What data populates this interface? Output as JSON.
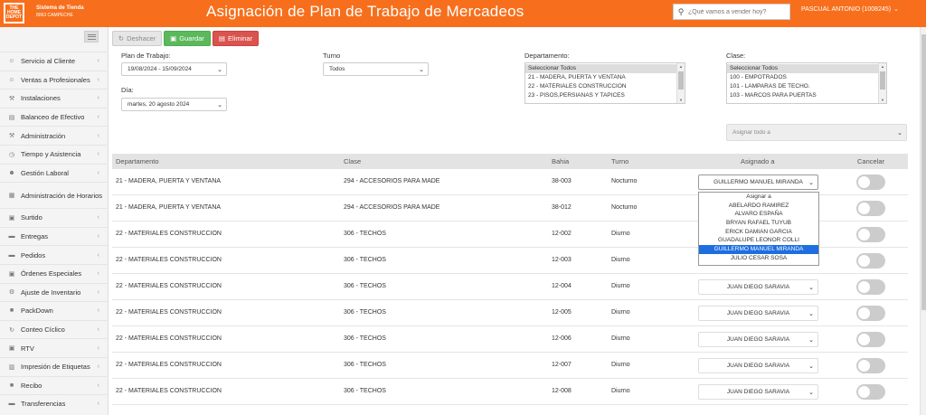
{
  "header": {
    "logo_text": "THE HOME DEPOT",
    "store_name": "Sistema de Tienda",
    "store_sub": "8063 CAMPECHE",
    "title": "Asignación de Plan de Trabajo de Mercadeos",
    "search_placeholder": "¿Qué vamos a vender hoy?",
    "user": "PASCUAL ANTONIO (1008245)"
  },
  "sidebar": {
    "items": [
      {
        "label": "Servicio al Cliente",
        "icon": "user-icon"
      },
      {
        "label": "Ventas a Profesionales",
        "icon": "user-icon"
      },
      {
        "label": "Instalaciones",
        "icon": "wrench-icon"
      },
      {
        "label": "Balanceo de Efectivo",
        "icon": "money-icon"
      },
      {
        "label": "Administración",
        "icon": "wrench-icon"
      },
      {
        "label": "Tiempo y Asistencia",
        "icon": "clock-icon"
      },
      {
        "label": "Gestión Laboral",
        "icon": "users-icon"
      },
      {
        "label": "Administración de Horarios",
        "icon": "calendar-icon"
      },
      {
        "label": "Surtido",
        "icon": "cart-icon"
      },
      {
        "label": "Entregas",
        "icon": "truck-icon"
      },
      {
        "label": "Pedidos",
        "icon": "truck-icon"
      },
      {
        "label": "Órdenes Especiales",
        "icon": "cart-icon"
      },
      {
        "label": "Ajuste de Inventario",
        "icon": "gear-icon"
      },
      {
        "label": "PackDown",
        "icon": "box-icon"
      },
      {
        "label": "Conteo Cíclico",
        "icon": "refresh-icon"
      },
      {
        "label": "RTV",
        "icon": "cart-icon"
      },
      {
        "label": "Impresión de Etiquetas",
        "icon": "print-icon"
      },
      {
        "label": "Recibo",
        "icon": "box-icon"
      },
      {
        "label": "Transferencias",
        "icon": "truck-icon"
      }
    ]
  },
  "toolbar": {
    "undo": "Deshacer",
    "save": "Guardar",
    "delete": "Eliminar"
  },
  "filters": {
    "plan_label": "Plan de Trabajo:",
    "plan_value": "19/08/2024 - 15/09/2024",
    "dia_label": "Día:",
    "dia_value": "martes, 20 agosto 2024",
    "turno_label": "Turno",
    "turno_value": "Todos",
    "departamento_label": "Departamento:",
    "departamento_options": [
      "Seleccionar Todos",
      "21 - MADERA, PUERTA Y VENTANA",
      "22 - MATERIALES CONSTRUCCION",
      "23 - PISOS,PERSIANAS Y TAPICES"
    ],
    "clase_label": "Clase:",
    "clase_options": [
      "Seleccionar Todos",
      "100 - EMPOTRADOS",
      "101 - LAMPARAS DE TECHO.",
      "103 - MARCOS PARA PUERTAS"
    ],
    "asignar_todo": "Asignar todo a"
  },
  "table": {
    "headers": {
      "departamento": "Departamento",
      "clase": "Clase",
      "bahia": "Bahia",
      "turno": "Turno",
      "asignado": "Asignado a",
      "cancelar": "Cancelar"
    },
    "rows": [
      {
        "departamento": "21 - MADERA, PUERTA Y VENTANA",
        "clase": "294 - ACCESORIOS PARA MADE",
        "bahia": "38-003",
        "turno": "Nocturno",
        "asignado": "GUILLERMO MANUEL MIRANDA"
      },
      {
        "departamento": "21 - MADERA, PUERTA Y VENTANA",
        "clase": "294 - ACCESORIOS PARA MADE",
        "bahia": "38-012",
        "turno": "Nocturno",
        "asignado": ""
      },
      {
        "departamento": "22 - MATERIALES CONSTRUCCION",
        "clase": "306 - TECHOS",
        "bahia": "12-002",
        "turno": "Diurno",
        "asignado": ""
      },
      {
        "departamento": "22 - MATERIALES CONSTRUCCION",
        "clase": "306 - TECHOS",
        "bahia": "12-003",
        "turno": "Diurno",
        "asignado": ""
      },
      {
        "departamento": "22 - MATERIALES CONSTRUCCION",
        "clase": "306 - TECHOS",
        "bahia": "12-004",
        "turno": "Diurno",
        "asignado": "JUAN DIEGO SARAVIA"
      },
      {
        "departamento": "22 - MATERIALES CONSTRUCCION",
        "clase": "306 - TECHOS",
        "bahia": "12-005",
        "turno": "Diurno",
        "asignado": "JUAN DIEGO SARAVIA"
      },
      {
        "departamento": "22 - MATERIALES CONSTRUCCION",
        "clase": "306 - TECHOS",
        "bahia": "12-006",
        "turno": "Diurno",
        "asignado": "JUAN DIEGO SARAVIA"
      },
      {
        "departamento": "22 - MATERIALES CONSTRUCCION",
        "clase": "306 - TECHOS",
        "bahia": "12-007",
        "turno": "Diurno",
        "asignado": "JUAN DIEGO SARAVIA"
      },
      {
        "departamento": "22 - MATERIALES CONSTRUCCION",
        "clase": "306 - TECHOS",
        "bahia": "12-008",
        "turno": "Diurno",
        "asignado": "JUAN DIEGO SARAVIA"
      }
    ]
  },
  "dropdown": {
    "options": [
      "Asignar a",
      "ABELARDO RAMIREZ",
      "ALVARO ESPAÑA",
      "BRYAN RAFAEL TUYUB",
      "ERICK DAMIAN GARCIA",
      "GUADALUPE LEONOR COLLI",
      "GUILLERMO MANUEL MIRANDA",
      "JULIO CESAR SOSA"
    ],
    "selected_index": 6
  }
}
